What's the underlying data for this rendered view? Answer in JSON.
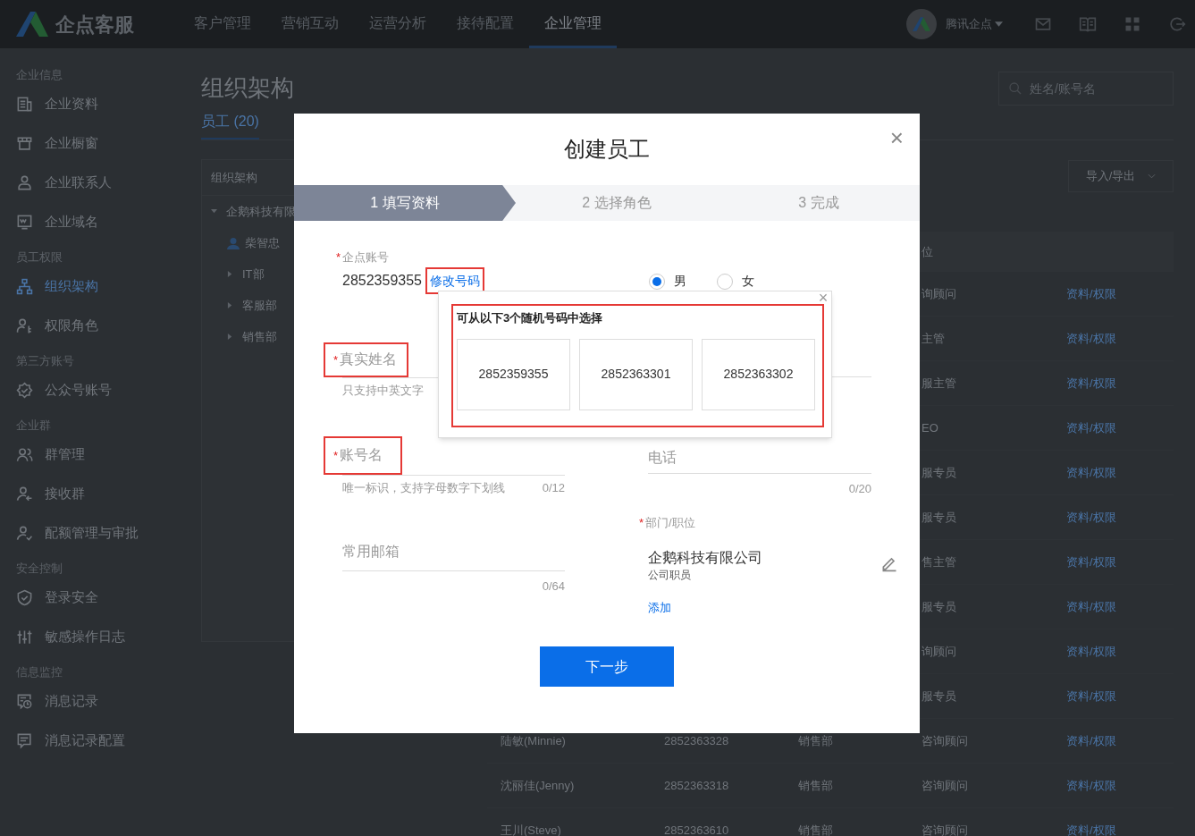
{
  "topbar": {
    "brand": "企点客服",
    "nav": [
      {
        "label": "客户管理",
        "selected": false
      },
      {
        "label": "营销互动",
        "selected": false
      },
      {
        "label": "运营分析",
        "selected": false
      },
      {
        "label": "接待配置",
        "selected": false
      },
      {
        "label": "企业管理",
        "selected": true
      }
    ],
    "account": "腾讯企点"
  },
  "sidebar": {
    "sections": [
      {
        "title": "企业信息",
        "items": [
          {
            "label": "企业资料",
            "selected": false
          },
          {
            "label": "企业橱窗",
            "selected": false
          },
          {
            "label": "企业联系人",
            "selected": false
          },
          {
            "label": "企业域名",
            "selected": false
          }
        ]
      },
      {
        "title": "员工权限",
        "items": [
          {
            "label": "组织架构",
            "selected": true
          },
          {
            "label": "权限角色",
            "selected": false
          }
        ]
      },
      {
        "title": "第三方账号",
        "items": [
          {
            "label": "公众号账号",
            "selected": false
          }
        ]
      },
      {
        "title": "企业群",
        "items": [
          {
            "label": "群管理",
            "selected": false
          },
          {
            "label": "接收群",
            "selected": false
          },
          {
            "label": "配额管理与审批",
            "selected": false
          }
        ]
      },
      {
        "title": "安全控制",
        "items": [
          {
            "label": "登录安全",
            "selected": false
          },
          {
            "label": "敏感操作日志",
            "selected": false
          }
        ]
      },
      {
        "title": "信息监控",
        "items": [
          {
            "label": "消息记录",
            "selected": false
          },
          {
            "label": "消息记录配置",
            "selected": false
          }
        ]
      }
    ]
  },
  "page": {
    "title": "组织架构",
    "tabs": [
      {
        "label": "员工 (20)",
        "selected": true
      }
    ],
    "search": {
      "placeholder": "姓名/账号名"
    },
    "tree": {
      "title": "组织架构",
      "nodes": [
        {
          "label": "企鹅科技有限",
          "expanded": true,
          "children": [
            {
              "label": "柴智忠",
              "kind": "person"
            },
            {
              "label": "IT部",
              "kind": "dept",
              "expanded": false
            },
            {
              "label": "客服部",
              "kind": "dept",
              "expanded": false
            },
            {
              "label": "销售部",
              "kind": "dept",
              "expanded": false
            }
          ]
        }
      ]
    },
    "import_export": "导入/导出",
    "table": {
      "header": {
        "position": "位"
      },
      "rows": [
        {
          "position": "询顾问",
          "action": "资料/权限"
        },
        {
          "position": "主管",
          "action": "资料/权限"
        },
        {
          "position": "服主管",
          "action": "资料/权限"
        },
        {
          "position": "EO",
          "action": "资料/权限"
        },
        {
          "position": "服专员",
          "action": "资料/权限"
        },
        {
          "position": "服专员",
          "action": "资料/权限"
        },
        {
          "position": "售主管",
          "action": "资料/权限"
        },
        {
          "position": "服专员",
          "action": "资料/权限"
        },
        {
          "position": "询顾问",
          "action": "资料/权限"
        },
        {
          "position": "服专员",
          "action": "资料/权限"
        },
        {
          "name": "陆敏(Minnie)",
          "account": "2852363328",
          "department": "销售部",
          "position": "咨询顾问",
          "action": "资料/权限"
        },
        {
          "name": "沈丽佳(Jenny)",
          "account": "2852363318",
          "department": "销售部",
          "position": "咨询顾问",
          "action": "资料/权限"
        },
        {
          "name": "王川(Steve)",
          "account": "2852363610",
          "department": "销售部",
          "position": "咨询顾问",
          "action": "资料/权限"
        }
      ]
    }
  },
  "dialog": {
    "title": "创建员工",
    "close": "×",
    "steps": [
      {
        "label": "1 填写资料",
        "selected": true
      },
      {
        "label": "2 选择角色",
        "selected": false
      },
      {
        "label": "3 完成",
        "selected": false
      }
    ],
    "account": {
      "label": "企点账号",
      "required_mark": "*",
      "value": "2852359355",
      "change_link": "修改号码",
      "highlighted": true
    },
    "gender": [
      {
        "label": "男",
        "selected": true
      },
      {
        "label": "女",
        "selected": false
      }
    ],
    "number_picker": {
      "title": "可从以下3个随机号码中选择",
      "close": "×",
      "options": [
        "2852359355",
        "2852363301",
        "2852363302"
      ],
      "highlighted": true
    },
    "real_name": {
      "label": "真实姓名",
      "required_mark": "*",
      "hint": "只支持中英文字",
      "highlighted": true
    },
    "account_name": {
      "label": "账号名",
      "required_mark": "*",
      "hint": "唯一标识，支持字母数字下划线",
      "counter": "0/12",
      "highlighted": true
    },
    "phone": {
      "placeholder": "电话",
      "counter": "0/20"
    },
    "email": {
      "placeholder": "常用邮箱",
      "counter": "0/64"
    },
    "department": {
      "label": "部门/职位",
      "required_mark": "*",
      "company": "企鹅科技有限公司",
      "role": "公司职员",
      "add_link": "添加"
    },
    "next_button": "下一步"
  }
}
